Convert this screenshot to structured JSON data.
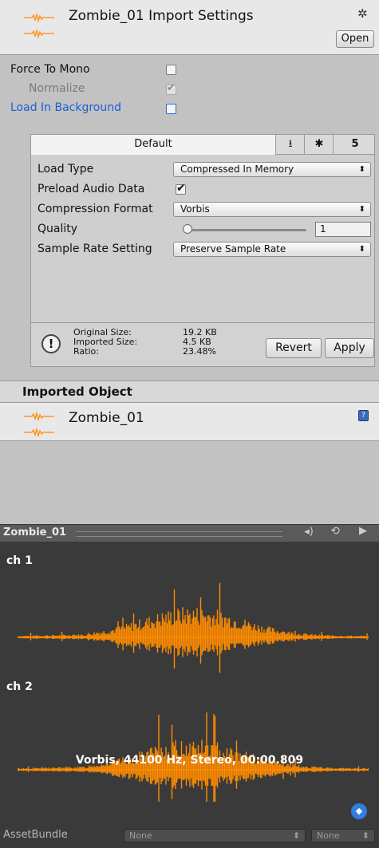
{
  "header": {
    "title": "Zombie_01 Import Settings",
    "open_label": "Open",
    "gear_icon": "gear-icon"
  },
  "options": {
    "force_to_mono": "Force To Mono",
    "force_to_mono_checked": false,
    "normalize": "Normalize",
    "normalize_checked": true,
    "load_in_background": "Load In Background",
    "load_in_background_checked": false
  },
  "platform_tabs": {
    "default_label": "Default",
    "icons": [
      "download-icon",
      "android-icon",
      "html5-icon"
    ]
  },
  "props": {
    "load_type_label": "Load Type",
    "load_type_value": "Compressed In Memory",
    "preload_label": "Preload Audio Data",
    "preload_checked": true,
    "compression_label": "Compression Format",
    "compression_value": "Vorbis",
    "quality_label": "Quality",
    "quality_value": "1",
    "sample_rate_label": "Sample Rate Setting",
    "sample_rate_value": "Preserve Sample Rate"
  },
  "info": {
    "original_size_label": "Original Size:",
    "original_size_value": "19.2 KB",
    "imported_size_label": "Imported Size:",
    "imported_size_value": "4.5 KB",
    "ratio_label": "Ratio:",
    "ratio_value": "23.48%"
  },
  "actions": {
    "revert_label": "Revert",
    "apply_label": "Apply"
  },
  "imported_object": {
    "section_title": "Imported Object",
    "name": "Zombie_01"
  },
  "preview": {
    "title": "Zombie_01",
    "channel1": "ch 1",
    "channel2": "ch 2",
    "format_info": "Vorbis, 44100 Hz, Stereo, 00:00.809",
    "wave_color": "#ff8c00"
  },
  "footer": {
    "asset_bundle_label": "AssetBundle",
    "bundle_value": "None",
    "variant_value": "None"
  }
}
